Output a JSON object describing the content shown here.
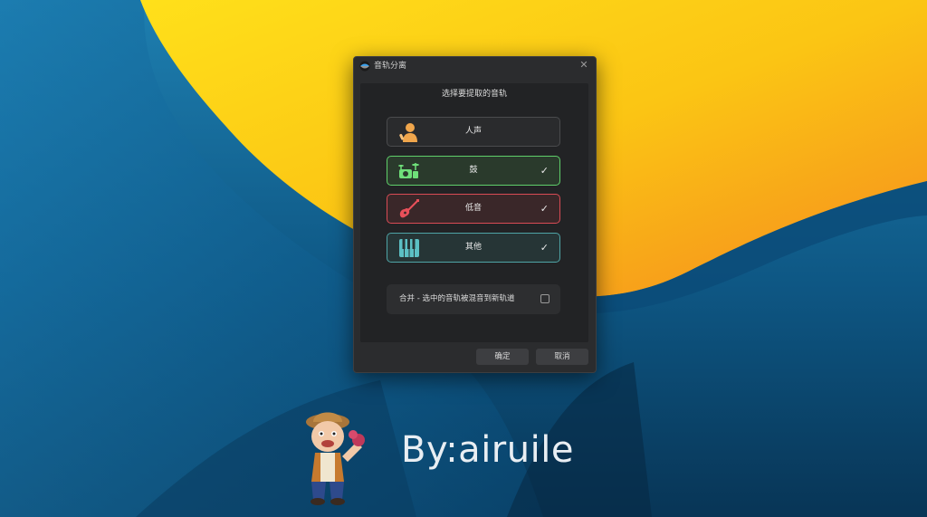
{
  "dialog": {
    "title": "音轨分离",
    "close_glyph": "✕",
    "prompt": "选择要提取的音轨",
    "tracks": [
      {
        "label": "人声",
        "icon": "singer-icon",
        "selected": false,
        "check": "",
        "accent": "#4a4b4d",
        "icon_color": "#f0a64c"
      },
      {
        "label": "鼓",
        "icon": "drum-icon",
        "selected": true,
        "check": "✓",
        "accent": "#5fcf6a",
        "icon_color": "#6fe07a"
      },
      {
        "label": "低音",
        "icon": "guitar-icon",
        "selected": true,
        "check": "✓",
        "accent": "#d94b55",
        "icon_color": "#e8505a"
      },
      {
        "label": "其他",
        "icon": "piano-icon",
        "selected": true,
        "check": "✓",
        "accent": "#4fa4a6",
        "icon_color": "#5cc0c4"
      }
    ],
    "merge": {
      "label": "合并 - 选中的音轨被混音到新轨道",
      "checked": false
    },
    "ok_label": "确定",
    "cancel_label": "取消"
  },
  "watermark": {
    "text": "By:airuile"
  },
  "colors": {
    "wallpaper_yellow": "#f7c21a",
    "wallpaper_orange": "#f59a1d",
    "wallpaper_blue": "#0f5a86",
    "dialog_bg": "#2b2c2e"
  }
}
